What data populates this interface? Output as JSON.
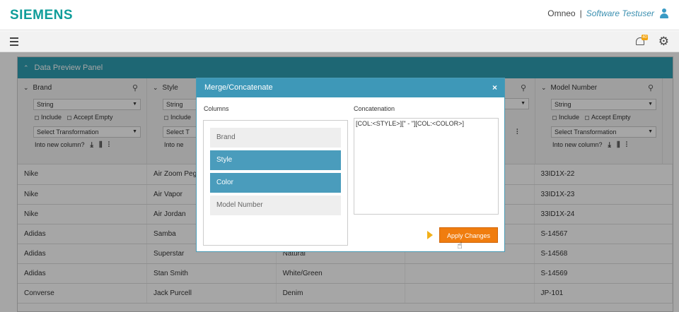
{
  "header": {
    "logo": "SIEMENS",
    "app_name": "Omneo",
    "separator": "|",
    "user_name": "Software Testuser",
    "user_icon": "user-icon"
  },
  "toolbar": {
    "menu_icon": "hamburger-icon",
    "notifications_icon": "bell-icon",
    "notifications_badge": "40",
    "settings_icon": "gear-icon"
  },
  "panel": {
    "title": "Data Preview Panel",
    "columns": [
      {
        "name": "Brand",
        "type": "String",
        "include": "Include",
        "accept_empty": "Accept Empty",
        "transformation": "Select Transformation",
        "into_new": "Into new column?"
      },
      {
        "name": "Style",
        "type": "String",
        "include": "Include",
        "accept_empty": "",
        "transformation": "Select T",
        "into_new": "Into ne"
      },
      {
        "name": "",
        "type": "",
        "include": "",
        "accept_empty": "",
        "transformation": "",
        "into_new": ""
      },
      {
        "name": "",
        "type": "",
        "include": "",
        "accept_empty": "",
        "transformation": "",
        "into_new": ""
      },
      {
        "name": "Model Number",
        "type": "String",
        "include": "Include",
        "accept_empty": "Accept Empty",
        "transformation": "Select Transformation",
        "into_new": "Into new column?"
      }
    ],
    "rows": [
      [
        "Nike",
        "Air Zoom Pega",
        "",
        "",
        "33ID1X-22"
      ],
      [
        "Nike",
        "Air Vapor",
        "",
        "",
        "33ID1X-23"
      ],
      [
        "Nike",
        "Air Jordan",
        "",
        "",
        "33ID1X-24"
      ],
      [
        "Adidas",
        "Samba",
        "",
        "",
        "S-14567"
      ],
      [
        "Adidas",
        "Superstar",
        "Natural",
        "",
        "S-14568"
      ],
      [
        "Adidas",
        "Stan Smith",
        "White/Green",
        "",
        "S-14569"
      ],
      [
        "Converse",
        "Jack Purcell",
        "Denim",
        "",
        "JP-101"
      ]
    ]
  },
  "modal": {
    "title": "Merge/Concatenate",
    "close": "×",
    "columns_label": "Columns",
    "concatenation_label": "Concatenation",
    "column_items": [
      {
        "label": "Brand",
        "active": false
      },
      {
        "label": "Style",
        "active": true
      },
      {
        "label": "Color",
        "active": true
      },
      {
        "label": "Model Number",
        "active": false
      }
    ],
    "concatenation_value": "[COL:<STYLE>][\" - \"][COL:<COLOR>]",
    "apply_label": "Apply Changes"
  },
  "colors": {
    "brand": "#0f9d9a",
    "panel_header": "#2f9fb3",
    "modal_header": "#3e98b8",
    "active_item": "#4a9cbc",
    "apply_button": "#f07d0f"
  }
}
